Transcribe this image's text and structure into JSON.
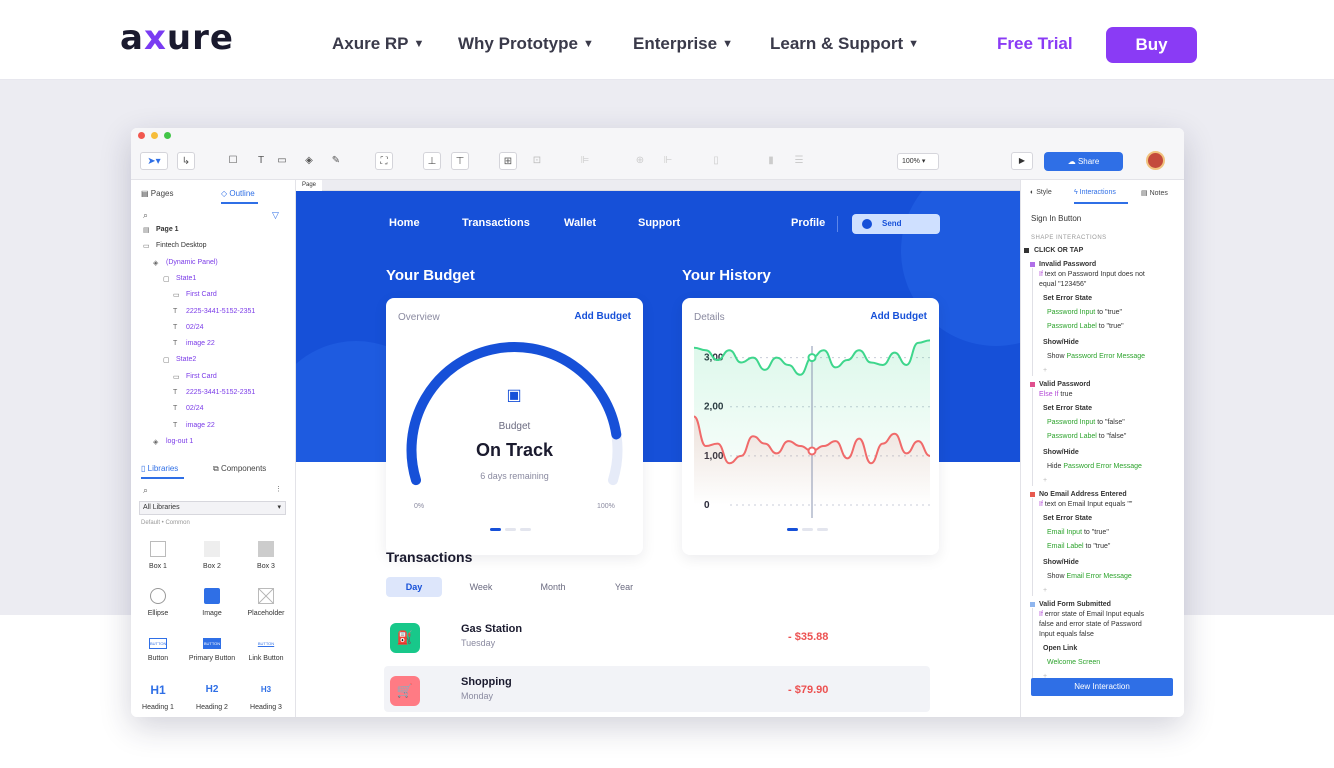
{
  "site": {
    "logo": {
      "pre": "a",
      "x": "x",
      "post": "ure"
    },
    "nav": [
      "Axure RP",
      "Why Prototype",
      "Enterprise",
      "Learn & Support"
    ],
    "caret": "▼",
    "free_trial": "Free Trial",
    "buy": "Buy"
  },
  "app": {
    "zoom": "100%",
    "share": "Share",
    "left_tabs": {
      "pages": "Pages",
      "outline": "Outline"
    },
    "outline": [
      {
        "label": "Page 1",
        "icon": "page-icon"
      },
      {
        "label": "Fintech Desktop",
        "icon": "folder-icon"
      },
      {
        "label": "(Dynamic Panel)",
        "icon": "layers-icon"
      },
      {
        "label": "State1",
        "icon": "state-icon"
      },
      {
        "label": "First Card",
        "icon": "rect-icon"
      },
      {
        "label": "2225-3441-5152-2351",
        "icon": "text-icon"
      },
      {
        "label": "02/24",
        "icon": "text-icon"
      },
      {
        "label": "image 22",
        "icon": "text-icon"
      },
      {
        "label": "State2",
        "icon": "state-icon"
      },
      {
        "label": "First Card",
        "icon": "rect-icon"
      },
      {
        "label": "2225-3441-5152-2351",
        "icon": "text-icon"
      },
      {
        "label": "02/24",
        "icon": "text-icon"
      },
      {
        "label": "image 22",
        "icon": "text-icon"
      },
      {
        "label": "log-out 1",
        "icon": "layers-icon"
      }
    ],
    "lib_tabs": {
      "libraries": "Libraries",
      "components": "Components"
    },
    "lib_select": "All Libraries",
    "lib_filter": "Default • Common",
    "widgets": [
      "Box 1",
      "Box 2",
      "Box 3",
      "Ellipse",
      "Image",
      "Placeholder",
      "Button",
      "Primary Button",
      "Link Button",
      "Heading 1",
      "Heading 2",
      "Heading 3"
    ],
    "widget_glyphs": {
      "btn": "BUTTON",
      "h1": "H1",
      "h2": "H2",
      "h3": "H3"
    },
    "page_tab": "Page 1",
    "right_tabs": {
      "style": "Style",
      "interactions": "Interactions",
      "notes": "Notes"
    },
    "selected": "Sign In Button",
    "shape_interactions": "SHAPE INTERACTIONS",
    "event": "CLICK OR TAP",
    "cases": [
      {
        "name": "Invalid Password",
        "cond_kw": "If",
        "cond": "text on Password Input does not",
        "cond2": "equal \"123456\"",
        "color": "#b06fe8",
        "actions": [
          {
            "title": "Set Error State",
            "lines": [
              {
                "target": "Password Input",
                "rest": "to \"true\""
              },
              {
                "target": "Password Label",
                "rest": "to \"true\""
              }
            ]
          },
          {
            "title": "Show/Hide",
            "lines": [
              {
                "pre": "Show",
                "target": "Password Error Message"
              }
            ]
          }
        ]
      },
      {
        "name": "Valid Password",
        "cond_kw": "Else If",
        "cond": "true",
        "cond2": "",
        "color": "#e0508e",
        "actions": [
          {
            "title": "Set Error State",
            "lines": [
              {
                "target": "Password Input",
                "rest": "to \"false\""
              },
              {
                "target": "Password Label",
                "rest": "to \"false\""
              }
            ]
          },
          {
            "title": "Show/Hide",
            "lines": [
              {
                "pre": "Hide",
                "target": "Password Error Message"
              }
            ]
          }
        ]
      },
      {
        "name": "No Email Address Entered",
        "cond_kw": "If",
        "cond": "text on Email Input equals \"\"",
        "cond2": "",
        "color": "#e85a4f",
        "actions": [
          {
            "title": "Set Error State",
            "lines": [
              {
                "target": "Email Input",
                "rest": "to \"true\""
              },
              {
                "target": "Email Label",
                "rest": "to \"true\""
              }
            ]
          },
          {
            "title": "Show/Hide",
            "lines": [
              {
                "pre": "Show",
                "target": "Email Error Message"
              }
            ]
          }
        ]
      },
      {
        "name": "Valid Form Submitted",
        "cond_kw": "If",
        "cond": "error state of Email Input equals",
        "cond2": "false and error state of Password",
        "cond3": "Input equals false",
        "color": "#8fb6ef",
        "actions": [
          {
            "title": "Open Link",
            "lines": [
              {
                "target": "Welcome Screen"
              }
            ]
          }
        ]
      }
    ],
    "plus": "+",
    "new_interaction": "New Interaction"
  },
  "proto": {
    "nav": [
      "Home",
      "Transactions",
      "Wallet",
      "Support"
    ],
    "profile": "Profile",
    "send": "Send",
    "budget": {
      "title": "Your Budget",
      "label": "Overview",
      "action": "Add Budget",
      "caption": "Budget",
      "status": "On Track",
      "remaining": "6 days remaining",
      "min": "0%",
      "max": "100%",
      "progress": 0.88
    },
    "history": {
      "title": "Your History",
      "label": "Details",
      "action": "Add Budget"
    },
    "transactions": {
      "title": "Transactions",
      "filters": [
        "Day",
        "Week",
        "Month",
        "Year"
      ],
      "active_filter": "Day",
      "items": [
        {
          "name": "Gas Station",
          "day": "Tuesday",
          "amount": "- $35.88",
          "color": "#18c88a",
          "icon": "fuel-icon"
        },
        {
          "name": "Shopping",
          "day": "Monday",
          "amount": "- $79.90",
          "color": "#ff7b84",
          "icon": "cart-icon"
        }
      ]
    }
  },
  "chart_data": {
    "type": "line",
    "title": "",
    "ylabel": "",
    "ylim": [
      0,
      3.5
    ],
    "yticks": [
      "0",
      "1,00",
      "2,00",
      "3,00"
    ],
    "x": [
      0,
      1,
      2,
      3,
      4,
      5,
      6,
      7,
      8,
      9,
      10,
      11,
      12,
      13,
      14,
      15,
      16,
      17,
      18,
      19,
      20
    ],
    "series": [
      {
        "color": "#3ed68c",
        "values": [
          3.2,
          3.15,
          2.95,
          3.15,
          2.9,
          3.0,
          2.75,
          3.0,
          2.85,
          2.65,
          3.0,
          3.15,
          2.8,
          2.95,
          3.15,
          2.9,
          2.85,
          3.1,
          2.85,
          3.3,
          3.35
        ]
      },
      {
        "color": "#f06a6a",
        "values": [
          1.8,
          1.2,
          1.25,
          0.85,
          1.0,
          1.4,
          1.25,
          1.05,
          1.3,
          1.2,
          1.1,
          1.2,
          1.3,
          0.95,
          1.35,
          0.85,
          1.25,
          1.45,
          1.05,
          1.3,
          1.0
        ]
      }
    ]
  }
}
